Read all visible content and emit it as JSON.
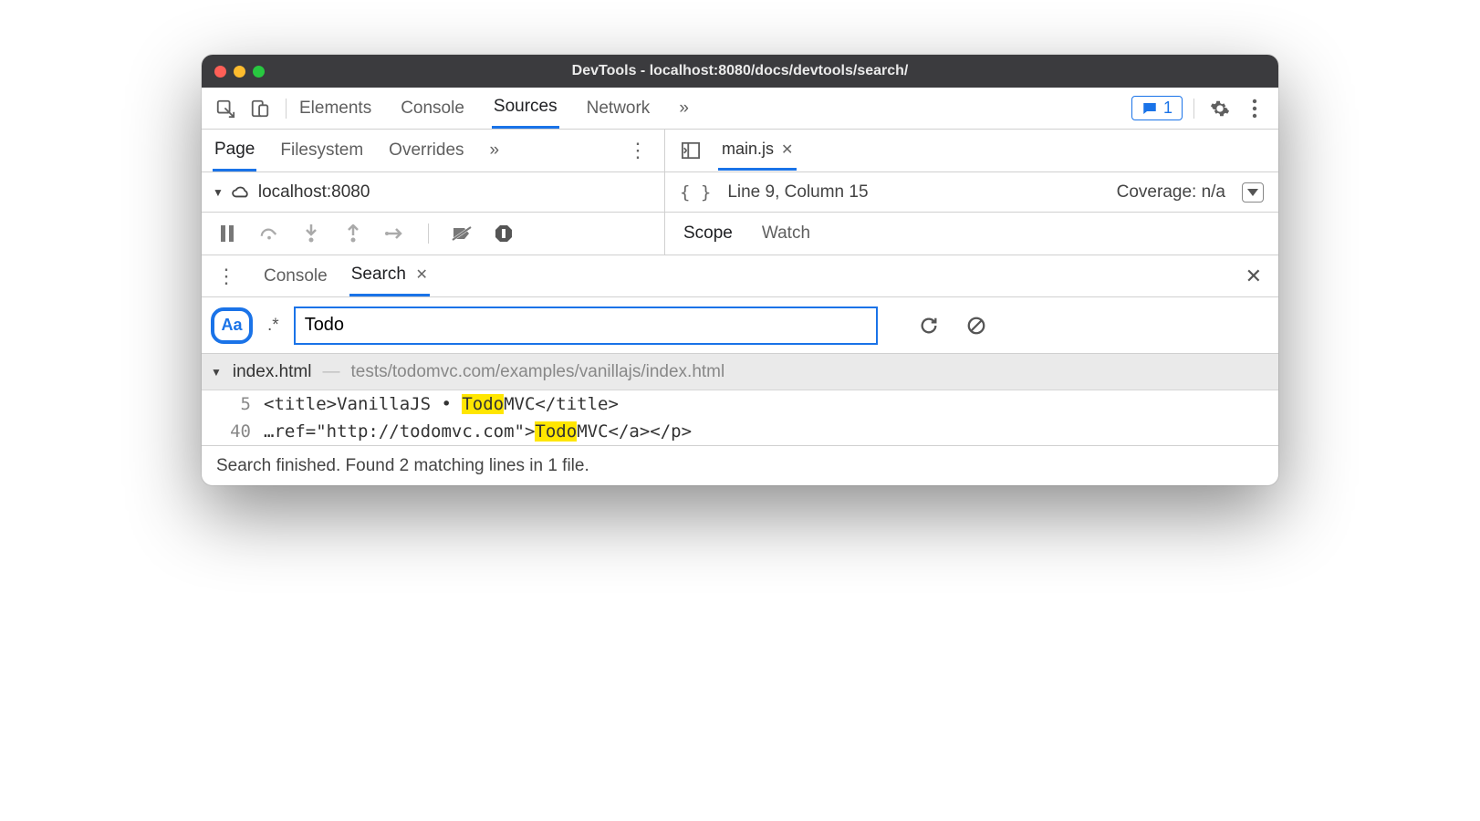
{
  "window": {
    "title": "DevTools - localhost:8080/docs/devtools/search/"
  },
  "main_tabs": {
    "elements": "Elements",
    "console": "Console",
    "sources": "Sources",
    "network": "Network",
    "more": "»"
  },
  "badge": {
    "count": "1"
  },
  "sources_subtabs": {
    "page": "Page",
    "filesystem": "Filesystem",
    "overrides": "Overrides",
    "more": "»"
  },
  "tree": {
    "host": "localhost:8080"
  },
  "editor": {
    "file_tab": "main.js",
    "cursor": "Line 9, Column 15",
    "coverage": "Coverage: n/a"
  },
  "debugger_tabs": {
    "scope": "Scope",
    "watch": "Watch"
  },
  "drawer_tabs": {
    "console": "Console",
    "search": "Search"
  },
  "search": {
    "case_label": "Aa",
    "regex_label": ".*",
    "query": "Todo"
  },
  "results": {
    "file": {
      "name": "index.html",
      "path": "tests/todomvc.com/examples/vanillajs/index.html"
    },
    "lines": [
      {
        "num": "5",
        "pre": "<title>VanillaJS • ",
        "match": "Todo",
        "post": "MVC</title>"
      },
      {
        "num": "40",
        "pre": "…ref=\"http://todomvc.com\">",
        "match": "Todo",
        "post": "MVC</a></p>"
      }
    ]
  },
  "status": "Search finished.  Found 2 matching lines in 1 file."
}
